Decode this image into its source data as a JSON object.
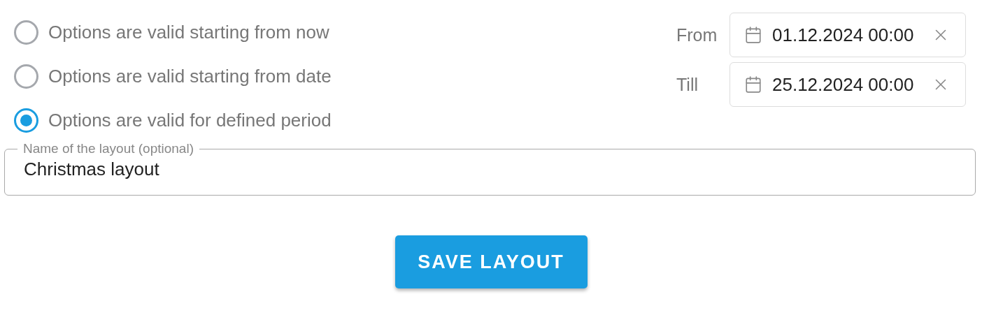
{
  "validity_options": [
    {
      "label": "Options are valid starting from now",
      "selected": false
    },
    {
      "label": "Options are valid starting from date",
      "selected": false
    },
    {
      "label": "Options are valid for defined period",
      "selected": true
    }
  ],
  "date_range": [
    {
      "label": "From",
      "value": "01.12.2024 00:00"
    },
    {
      "label": "Till",
      "value": "25.12.2024 00:00"
    }
  ],
  "layout_name": {
    "label": "Name of the layout (optional)",
    "value": "Christmas layout"
  },
  "save_button": "SAVE LAYOUT"
}
